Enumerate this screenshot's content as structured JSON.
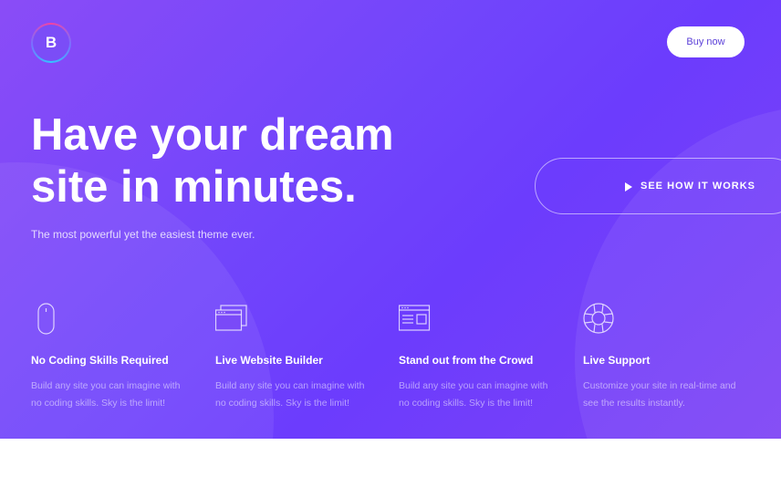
{
  "header": {
    "logo_letter": "B",
    "buy_label": "Buy now"
  },
  "hero": {
    "headline_line1": "Have your dream",
    "headline_line2": "site in minutes.",
    "subtitle": "The most powerful yet the easiest theme ever.",
    "cta_label": "SEE HOW IT WORKS"
  },
  "features": [
    {
      "icon": "mouse-icon",
      "title": "No Coding Skills Required",
      "line1": "Build any site you can imagine with",
      "line2": "no coding skills. Sky is the limit!"
    },
    {
      "icon": "windows-icon",
      "title": "Live Website Builder",
      "line1": "Build any site you can imagine with",
      "line2": "no coding skills. Sky is the limit!"
    },
    {
      "icon": "browser-layout-icon",
      "title": "Stand out from the Crowd",
      "line1": "Build any site you can imagine with",
      "line2": "no coding skills. Sky is the limit!"
    },
    {
      "icon": "lifebuoy-icon",
      "title": "Live Support",
      "line1": "Customize your site in real-time and",
      "line2": "see the results instantly."
    }
  ],
  "colors": {
    "gradient_start": "#8a4cf7",
    "gradient_end": "#6c3cfd",
    "button_text": "#5b3fd8"
  }
}
